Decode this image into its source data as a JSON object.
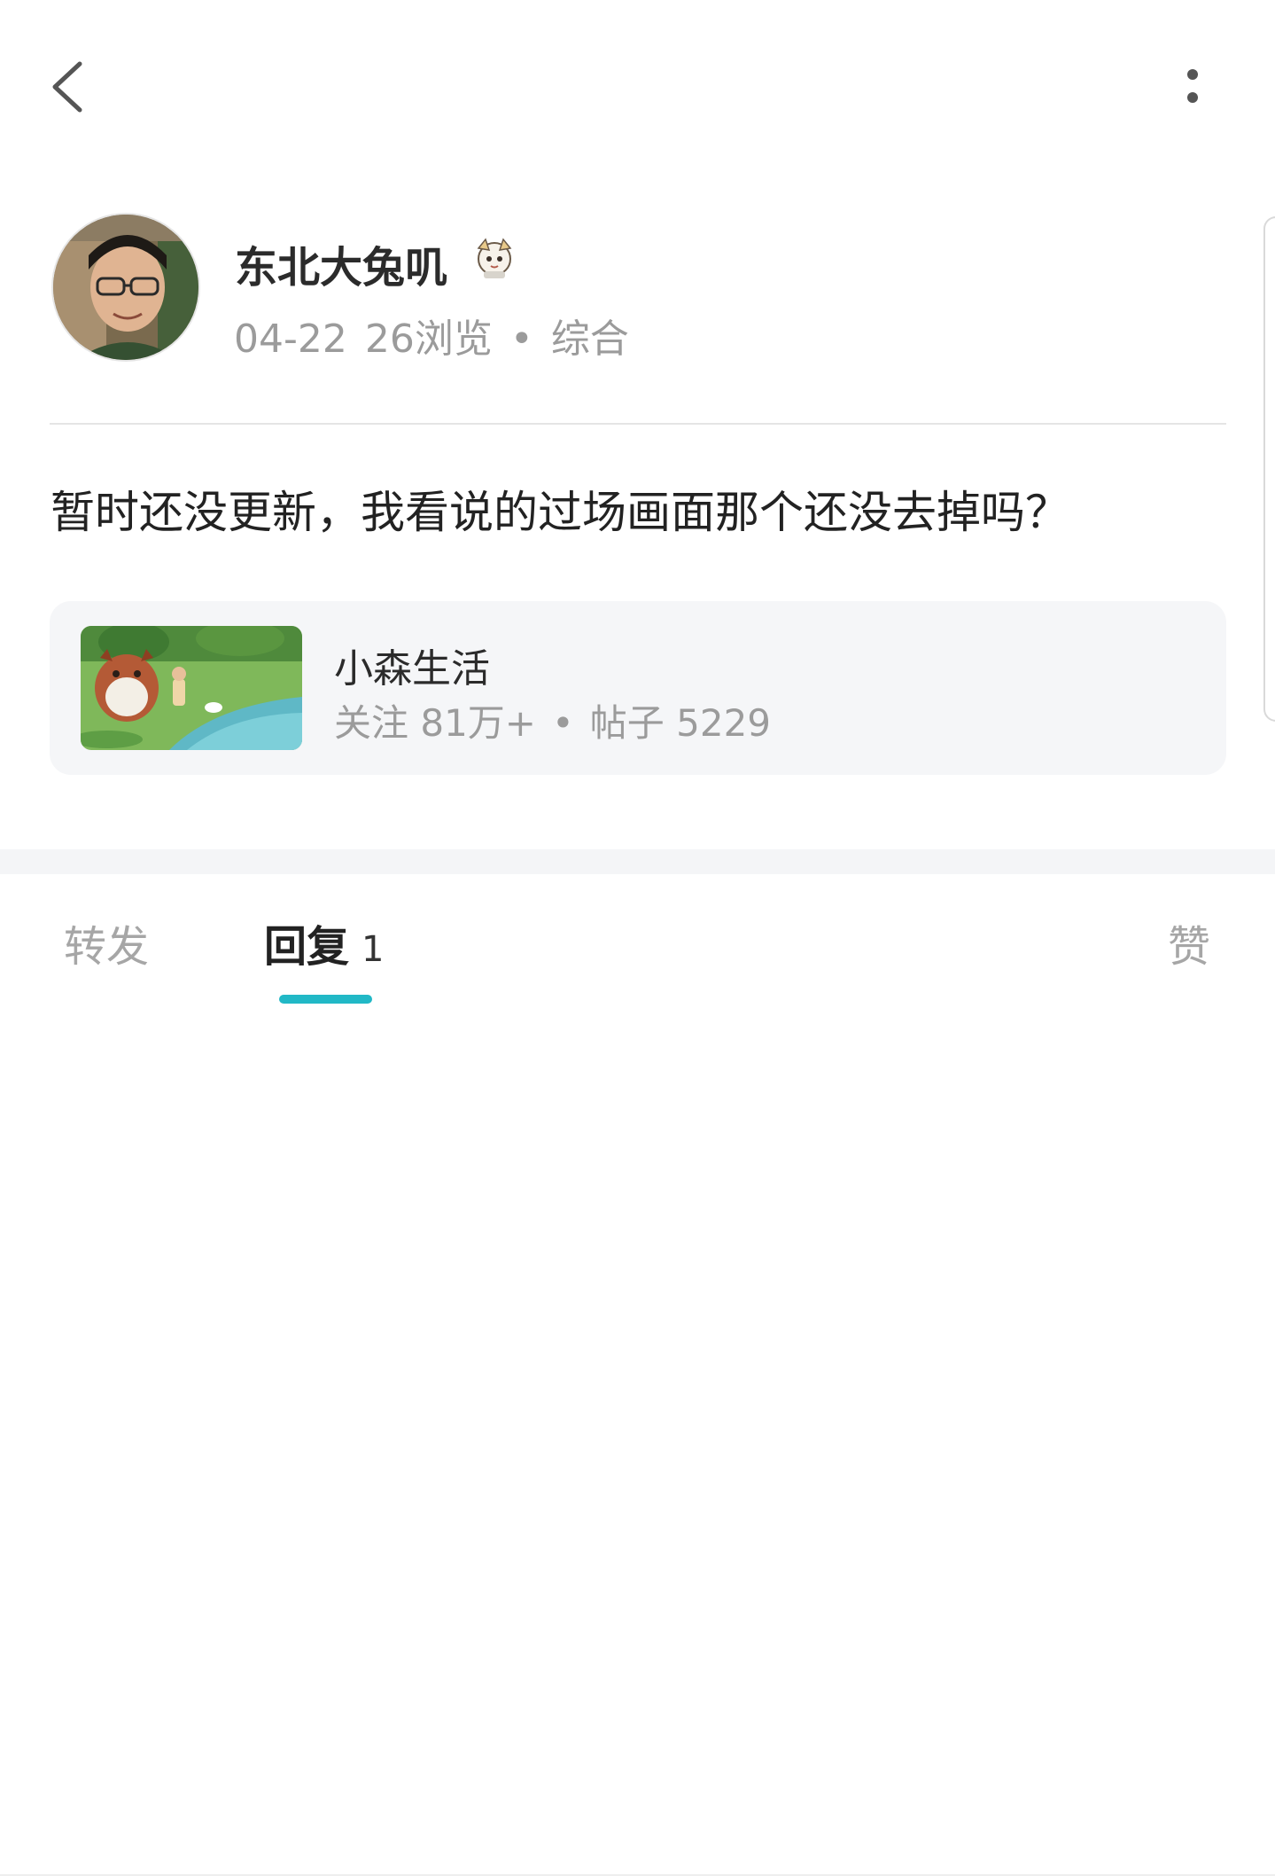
{
  "topbar": {
    "back_icon": "chevron-left-icon",
    "more_icon": "vertical-dots-icon"
  },
  "author": {
    "name": "东北大兔叽",
    "badge_icon": "character-badge-icon",
    "date": "04-22",
    "views": "26浏览",
    "separator": "•",
    "category": "综合"
  },
  "post": {
    "text": "暂时还没更新，我看说的过场画面那个还没去掉吗？"
  },
  "forum": {
    "name": "小森生活",
    "followers": "关注 81万+",
    "separator": "•",
    "posts": "帖子 5229"
  },
  "tabs": {
    "repost": "转发",
    "reply": "回复",
    "reply_count": "1",
    "like": "赞",
    "active": "reply",
    "accent_color": "#21b8c6"
  }
}
